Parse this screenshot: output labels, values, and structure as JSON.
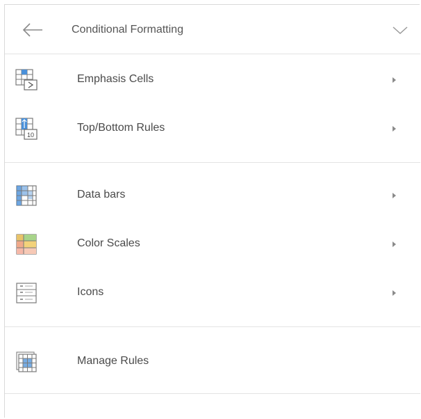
{
  "header": {
    "title": "Conditional Formatting",
    "back_icon": "back-arrow-icon",
    "collapse_icon": "chevron-down-icon"
  },
  "groups": [
    {
      "items": [
        {
          "label": "Emphasis Cells",
          "icon": "emphasis-cells-icon",
          "has_submenu": true
        },
        {
          "label": "Top/Bottom Rules",
          "icon": "top-bottom-rules-icon",
          "has_submenu": true
        }
      ]
    },
    {
      "items": [
        {
          "label": "Data bars",
          "icon": "data-bars-icon",
          "has_submenu": true
        },
        {
          "label": "Color Scales",
          "icon": "color-scales-icon",
          "has_submenu": true
        },
        {
          "label": "Icons",
          "icon": "icon-sets-icon",
          "has_submenu": true
        }
      ]
    },
    {
      "items": [
        {
          "label": "Manage Rules",
          "icon": "manage-rules-icon",
          "has_submenu": false
        }
      ]
    }
  ],
  "top_bottom_icon_text": "10",
  "colors": {
    "text": "#4a4a4a",
    "divider": "#e3e3e3",
    "icon_blue": "#4a90d9",
    "icon_grid": "#8a8a8a"
  }
}
